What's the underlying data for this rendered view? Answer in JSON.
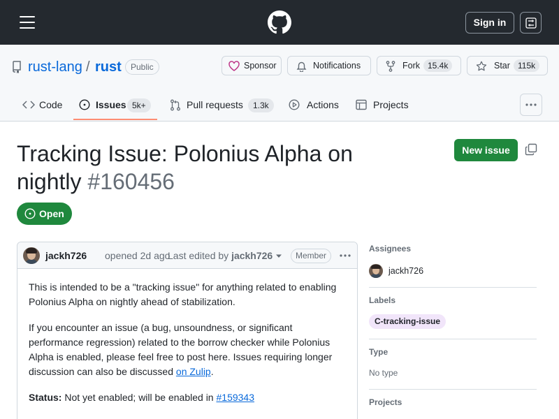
{
  "topbar": {
    "signin_label": "Sign in"
  },
  "repo": {
    "owner": "rust-lang",
    "separator": "/",
    "name": "rust",
    "visibility": "Public",
    "sponsor_label": "Sponsor",
    "notifications_label": "Notifications",
    "fork_label": "Fork",
    "fork_count": "15.4k",
    "star_label": "Star",
    "star_count": "115k"
  },
  "tabs": [
    {
      "label": "Code"
    },
    {
      "label": "Issues",
      "count": "5k+",
      "active": true
    },
    {
      "label": "Pull requests",
      "count": "1.3k"
    },
    {
      "label": "Actions"
    },
    {
      "label": "Projects"
    }
  ],
  "issue": {
    "title": "Tracking Issue: Polonius Alpha on nightly",
    "number": "#160456",
    "state": "Open",
    "new_issue_label": "New issue"
  },
  "comment": {
    "author": "jackh726",
    "opened_text": "opened 2d ago",
    "edited_prefix": "Last edited by",
    "edited_by": "jackh726",
    "role": "Member",
    "paragraphs": [
      "This is intended to be a \"tracking issue\" for anything related to enabling Polonius Alpha on nightly ahead of stabilization.",
      "If you encounter an issue (a bug, unsoundness, or significant performance regression) related to the borrow checker while Polonius Alpha is enabled, please feel free to post here. Issues requiring longer discussion can also be discussed"
    ],
    "zulip_link": "on Zulip",
    "period": ".",
    "status_label": "Status:",
    "status_text": "Not yet enabled; will be enabled in",
    "status_link": "#159343"
  },
  "sidebar": {
    "assignees_heading": "Assignees",
    "assignee": "jackh726",
    "labels_heading": "Labels",
    "label": "C-tracking-issue",
    "label_color": "#f1e5fa",
    "type_heading": "Type",
    "type_value": "No type",
    "projects_heading": "Projects"
  },
  "colors": {
    "header_bg": "#24292f",
    "open_green": "#1f883d",
    "link_blue": "#0969da",
    "active_tab_underline": "#fd8c73"
  }
}
